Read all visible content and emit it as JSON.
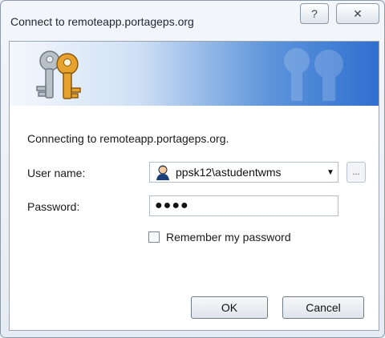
{
  "window": {
    "title": "Connect to remoteapp.portageps.org",
    "help_glyph": "?",
    "close_glyph": "✕"
  },
  "dialog": {
    "message": "Connecting to remoteapp.portageps.org.",
    "username_label": "User name:",
    "username_value": "ppsk12\\astudentwms",
    "password_label": "Password:",
    "password_mask": "●●●●",
    "remember_label": "Remember my password",
    "remember_checked": false,
    "browse_label": "...",
    "ok_label": "OK",
    "cancel_label": "Cancel"
  },
  "icons": [
    "keys-icon",
    "user-icon",
    "chevron-down-icon"
  ],
  "colors": {
    "banner_light": "#f4f8fd",
    "banner_dark": "#2f6fd0",
    "key_gold": "#e6a22c",
    "key_silver": "#b8c0c8"
  }
}
